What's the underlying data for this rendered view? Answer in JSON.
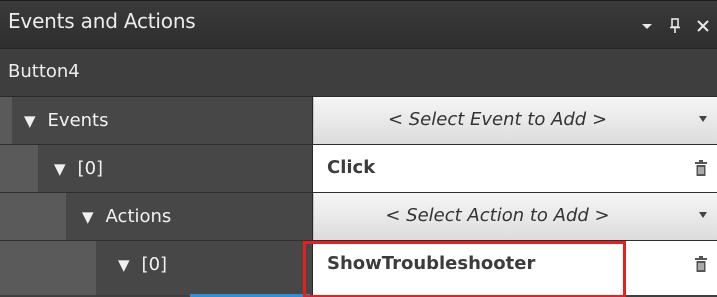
{
  "panel": {
    "title": "Events and Actions",
    "controls": {
      "dropdown_icon": "chevron-down-icon",
      "pin_icon": "pin-icon",
      "close_icon": "close-icon",
      "pin_glyph": "Ⳓ",
      "close_glyph": "×"
    },
    "subtitle": "Button4"
  },
  "rows": [
    {
      "label": "Events",
      "value_type": "select",
      "value": "< Select Event to Add >"
    },
    {
      "label": "[0]",
      "value_type": "text",
      "value": "Click"
    },
    {
      "label": "Actions",
      "value_type": "select",
      "value": "< Select Action to Add >"
    },
    {
      "label": "[0]",
      "value_type": "text",
      "value": "ShowTroubleshooter"
    }
  ],
  "colors": {
    "highlight": "#e42020",
    "accent": "#2e8fd8"
  }
}
